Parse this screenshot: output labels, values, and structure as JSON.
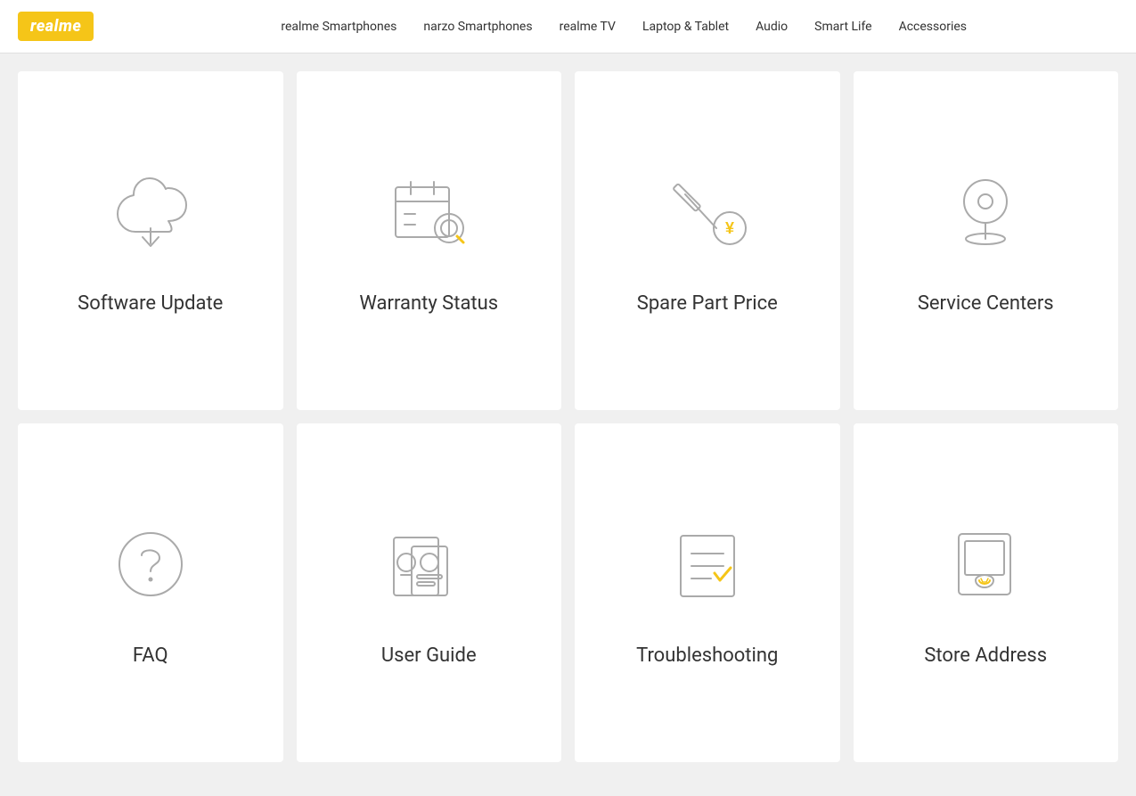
{
  "header": {
    "logo": "realme",
    "nav": [
      {
        "label": "realme Smartphones",
        "id": "nav-realme-smartphones"
      },
      {
        "label": "narzo Smartphones",
        "id": "nav-narzo-smartphones"
      },
      {
        "label": "realme TV",
        "id": "nav-realme-tv"
      },
      {
        "label": "Laptop & Tablet",
        "id": "nav-laptop-tablet"
      },
      {
        "label": "Audio",
        "id": "nav-audio"
      },
      {
        "label": "Smart Life",
        "id": "nav-smart-life"
      },
      {
        "label": "Accessories",
        "id": "nav-accessories"
      }
    ]
  },
  "cards": [
    {
      "id": "software-update",
      "label": "Software Update",
      "icon": "cloud-download"
    },
    {
      "id": "warranty-status",
      "label": "Warranty Status",
      "icon": "calendar-search"
    },
    {
      "id": "spare-part-price",
      "label": "Spare Part Price",
      "icon": "tool-price"
    },
    {
      "id": "service-centers",
      "label": "Service Centers",
      "icon": "location-pin"
    },
    {
      "id": "faq",
      "label": "FAQ",
      "icon": "question-circle"
    },
    {
      "id": "user-guide",
      "label": "User Guide",
      "icon": "id-document"
    },
    {
      "id": "troubleshooting",
      "label": "Troubleshooting",
      "icon": "checklist"
    },
    {
      "id": "store-address",
      "label": "Store Address",
      "icon": "store-phone"
    }
  ]
}
